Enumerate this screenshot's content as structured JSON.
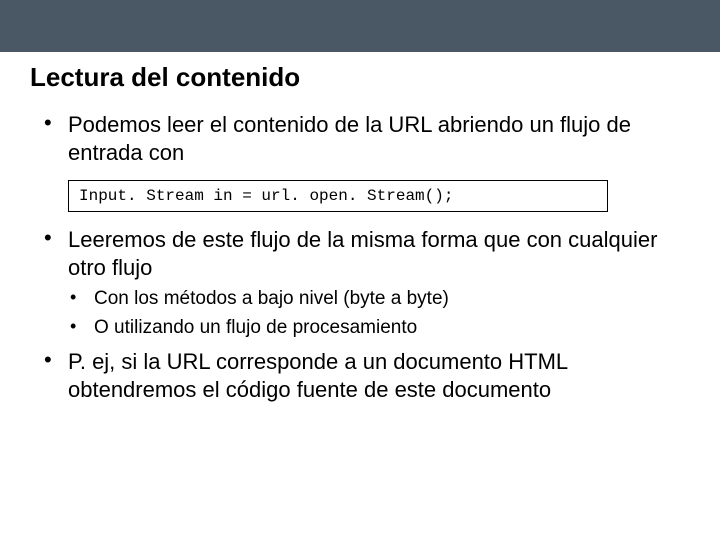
{
  "slide": {
    "title": "Lectura del contenido",
    "bullets": [
      {
        "text": "Podemos leer el contenido de la URL abriendo un flujo de entrada con"
      },
      {
        "code": "Input. Stream in = url. open. Stream();"
      },
      {
        "text": "Leeremos de este flujo de la misma forma que con cualquier otro flujo",
        "sub": [
          "Con los métodos a bajo nivel (byte a byte)",
          "O utilizando un flujo de procesamiento"
        ]
      },
      {
        "text": "P. ej, si la URL corresponde a un documento HTML obtendremos el código fuente de este documento"
      }
    ]
  }
}
